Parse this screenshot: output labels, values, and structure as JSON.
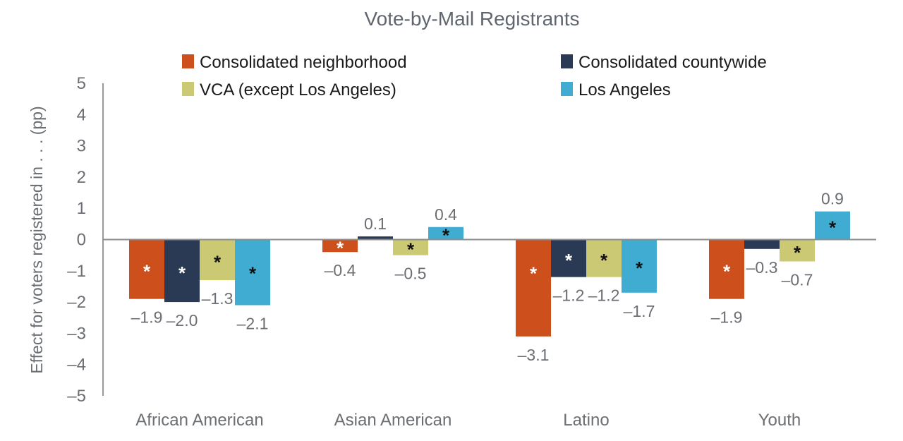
{
  "chart_data": {
    "type": "bar",
    "title": "Vote-by-Mail Registrants",
    "xlabel": "",
    "ylabel": "Effect for voters registered in . . . (pp)",
    "ylim": [
      -5,
      5
    ],
    "yticks": [
      5,
      4,
      3,
      2,
      1,
      0,
      -1,
      -2,
      -3,
      -4,
      -5
    ],
    "ytick_labels": [
      "5",
      "4",
      "3",
      "2",
      "1",
      "0",
      "–1",
      "–2",
      "–3",
      "–4",
      "–5"
    ],
    "grid": false,
    "legend_position": "top",
    "categories": [
      "African American",
      "Asian American",
      "Latino",
      "Youth"
    ],
    "series": [
      {
        "name": "Consolidated neighborhood",
        "color": "#cc4f1c",
        "values": [
          -1.9,
          -0.4,
          -3.1,
          -1.9
        ],
        "labels": [
          "–1.9",
          "–0.4",
          "–3.1",
          "–1.9"
        ],
        "significant": [
          true,
          true,
          true,
          true
        ],
        "star_color": "#ffffff"
      },
      {
        "name": "Consolidated countywide",
        "color": "#2a3a55",
        "values": [
          -2.0,
          0.1,
          -1.2,
          -0.3
        ],
        "labels": [
          "–2.0",
          "0.1",
          "–1.2",
          "–0.3"
        ],
        "significant": [
          true,
          false,
          true,
          false
        ],
        "star_color": "#ffffff"
      },
      {
        "name": "VCA (except Los Angeles)",
        "color": "#cbc974",
        "values": [
          -1.3,
          -0.5,
          -1.2,
          -0.7
        ],
        "labels": [
          "–1.3",
          "–0.5",
          "–1.2",
          "–0.7"
        ],
        "significant": [
          true,
          true,
          true,
          true
        ],
        "star_color": "#111111"
      },
      {
        "name": "Los Angeles",
        "color": "#41acd1",
        "values": [
          -2.1,
          0.4,
          -1.7,
          0.9
        ],
        "labels": [
          "–2.1",
          "0.4",
          "–1.7",
          "0.9"
        ],
        "significant": [
          true,
          true,
          true,
          true
        ],
        "star_color": "#111111"
      }
    ],
    "significance_marker": "*"
  }
}
